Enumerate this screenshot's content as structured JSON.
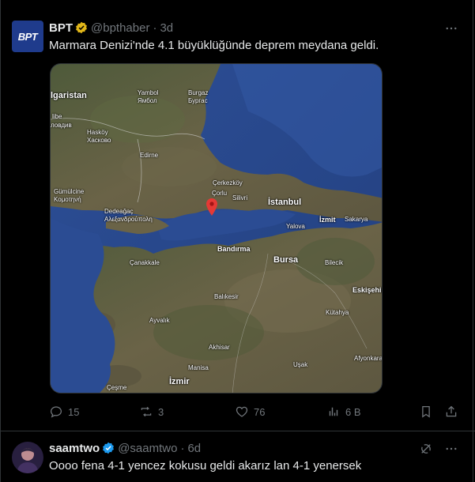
{
  "tweet1": {
    "avatar_text": "BPT",
    "name": "BPT",
    "handle": "@bpthaber",
    "dot": "·",
    "time": "3d",
    "text": "Marmara Denizi'nde 4.1 büyüklüğünde deprem meydana geldi.",
    "map_labels": {
      "bulgaristan": "lgaristan",
      "libe": "libe",
      "plovdiv": "ловдив",
      "yambol_tr": "Yambol",
      "yambol_bg": "Ямбол",
      "burgaz_tr": "Burgaz",
      "burgaz_bg": "Бургас",
      "haskovo_tr": "Hasköy",
      "haskovo_bg": "Хасково",
      "edirne": "Edirne",
      "gumulcine_tr": "Gümülcine",
      "gumulcine_gr": "Κομοτηνή",
      "dedeagac_tr": "Dedeağaç",
      "dedeagac_gr": "Αλεξανδρούπολη",
      "cerkezkoy": "Çerkezköy",
      "corlu": "Çorlu",
      "silivri": "Silivri",
      "istanbul": "İstanbul",
      "izmit": "İzmit",
      "sakarya": "Sakarya",
      "yalova": "Yalova",
      "canakkale": "Çanakkale",
      "bandirma": "Bandırma",
      "bursa": "Bursa",
      "bilecik": "Bilecik",
      "eskisehir": "Eskişehir",
      "balikesir": "Balıkesir",
      "kutahya": "Kütahya",
      "ayvalik": "Ayvalık",
      "akhisar": "Akhisar",
      "usak": "Uşak",
      "afyon": "Afyonkarahi",
      "manisa": "Manisa",
      "izmir": "İzmir",
      "cesme": "Çeşme"
    },
    "stats": {
      "replies": "15",
      "reposts": "3",
      "likes": "76",
      "views": "6 B"
    }
  },
  "tweet2": {
    "name": "saamtwo",
    "handle": "@saamtwo",
    "dot": "·",
    "time": "6d",
    "text": "Oooo fena 4-1 yencez kokusu geldi akarız lan 4-1 yenersek"
  },
  "colors": {
    "verified_gold": "#e2b719",
    "verified_blue": "#1d9bf0",
    "muted": "#71767b",
    "text": "#e7e9ea",
    "border": "#2f3336",
    "sea": "#2a4a8c",
    "land": "#5a5a3e",
    "pin": "#e53935"
  }
}
